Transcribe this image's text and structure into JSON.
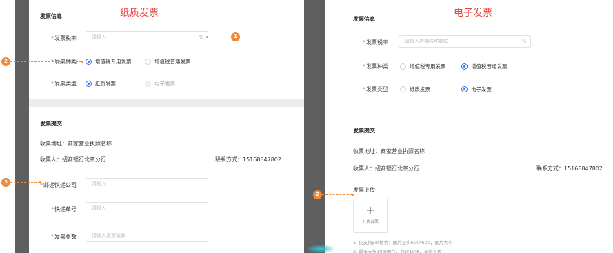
{
  "left": {
    "heading": "纸质发票",
    "info_title": "发票信息",
    "tax_rate": {
      "label": "发票税率",
      "placeholder": "请输入",
      "suffix": "%"
    },
    "invoice_kind": {
      "label": "发票种类",
      "options": [
        "增值税专用发票",
        "增值税普通发票"
      ]
    },
    "invoice_type": {
      "label": "发票类型",
      "options": [
        "纸质发票",
        "电子发票"
      ]
    },
    "submit_title": "发票提交",
    "address": "收票地址：商家营业执照名称",
    "receiver": "收票人：招商银行北京分行",
    "contact": "联系方式：15168847802",
    "courier": {
      "label": "邮递快递公司",
      "placeholder": "请输入"
    },
    "tracking": {
      "label": "快递单号",
      "placeholder": "请输入"
    },
    "count": {
      "label": "发票张数",
      "placeholder": "请输入发票张数"
    }
  },
  "right": {
    "heading": "电子发票",
    "info_title": "发票信息",
    "tax_rate": {
      "label": "发票税率",
      "placeholder": "请输入店铺名称或ID",
      "suffix": "%"
    },
    "invoice_kind": {
      "label": "发票种类",
      "options": [
        "增值税专用发票",
        "增值税普通发票"
      ]
    },
    "invoice_type": {
      "label": "发票类型",
      "options": [
        "纸质发票",
        "电子发票"
      ]
    },
    "submit_title": "发票提交",
    "address": "收票地址：商家营业执照名称",
    "receiver": "收票人：招商银行北京分行",
    "contact": "联系方式：15168847802",
    "upload_title": "发票上传",
    "upload_button": "上传发票",
    "upload_hint_1": "1. 仅支持pdf格式；图片至少600*600，图片大小",
    "upload_hint_2": "2. 最多支持10张图片，超过10张，支持上传"
  },
  "badges": [
    "1",
    "2",
    "3",
    "2"
  ],
  "colors": {
    "accent_orange": "#ef8a3a",
    "heading_red": "#e8453c",
    "radio_blue": "#2f6fe0",
    "side_bar": "#5f5f5f"
  }
}
